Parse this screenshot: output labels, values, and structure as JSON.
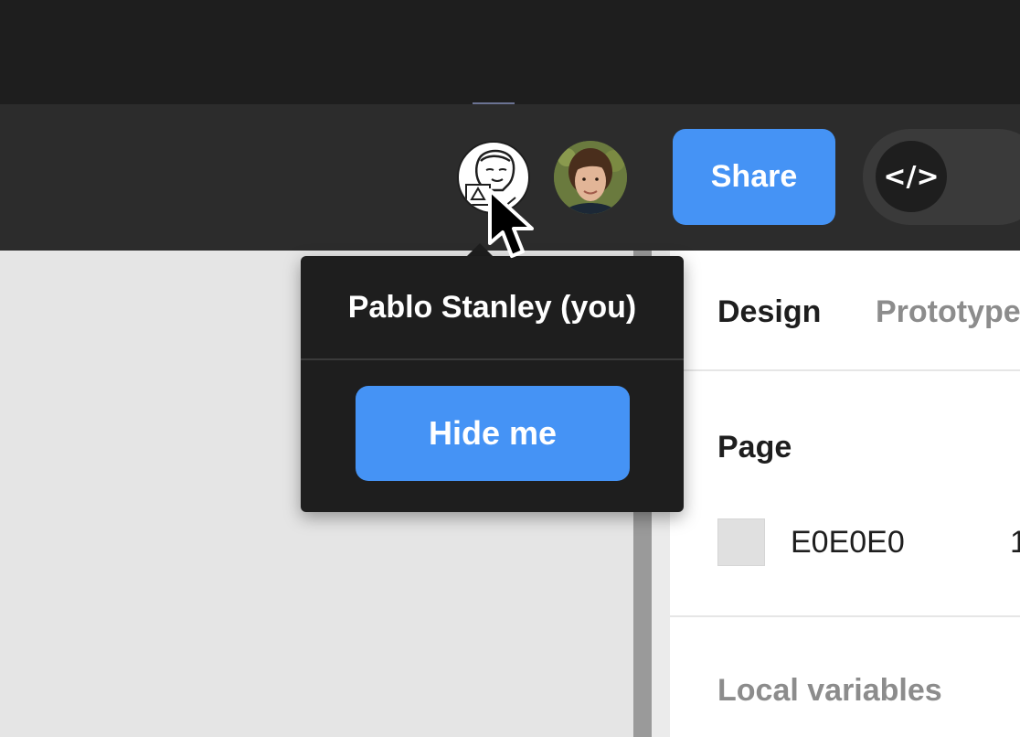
{
  "toolbar": {
    "share_label": "Share",
    "dev_mode_icon": "code-brackets-icon",
    "dev_mode_glyph": "</>"
  },
  "avatars": [
    {
      "role": "self",
      "icon": "sketch-avatar-icon"
    },
    {
      "role": "collaborator",
      "icon": "photo-avatar-icon"
    }
  ],
  "tooltip": {
    "user_name": "Pablo Stanley (you)",
    "hide_label": "Hide me"
  },
  "panel": {
    "tabs": [
      {
        "label": "Design",
        "active": true
      },
      {
        "label": "Prototype",
        "active": false
      }
    ],
    "page_section": {
      "title": "Page",
      "background_hex": "E0E0E0",
      "opacity_partial": "1"
    },
    "variables_section": {
      "title": "Local variables"
    }
  },
  "colors": {
    "accent": "#4593f5",
    "toolbar_bg": "#2c2c2c",
    "titlebar_bg": "#1e1e1e",
    "canvas_bg": "#e5e5e5",
    "page_swatch": "#e0e0e0"
  }
}
